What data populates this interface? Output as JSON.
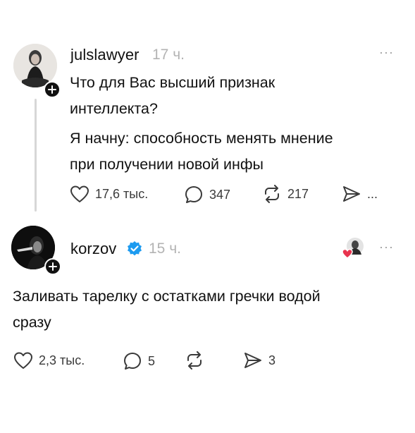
{
  "posts": [
    {
      "username": "julslawyer",
      "time": "17 ч.",
      "more": "···",
      "text": [
        "Что для Вас высший признак",
        "интеллекта?",
        "Я начну: способность менять мнение",
        "при получении новой инфы"
      ],
      "actions": {
        "likes": "17,6 тыс.",
        "replies": "347",
        "reposts": "217",
        "shares": "..."
      }
    },
    {
      "username": "korzov",
      "verified": true,
      "time": "15 ч.",
      "more": "···",
      "text": [
        "Заливать тарелку с остатками гречки водой",
        "сразу"
      ],
      "actions": {
        "likes": "2,3 тыс.",
        "replies": "5",
        "reposts": "",
        "shares": "3"
      }
    }
  ],
  "colors": {
    "text": "#111111",
    "muted": "#b3b3b3",
    "verified": "#1d9bf0",
    "heart": "#e8344e",
    "thread_line": "#d7d7d7"
  }
}
